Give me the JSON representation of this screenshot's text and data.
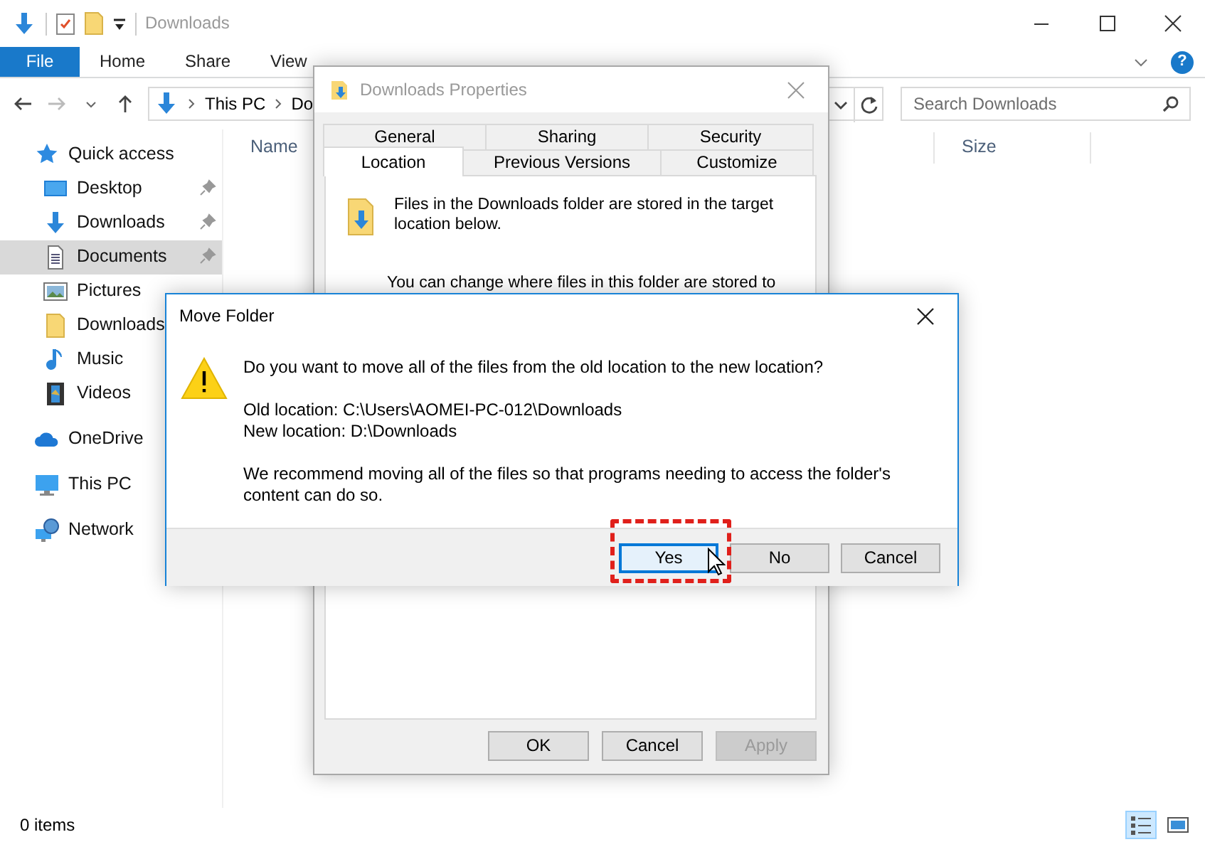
{
  "explorer": {
    "title": "Downloads",
    "ribbon_tabs": [
      {
        "label": "File",
        "kind": "file"
      },
      {
        "label": "Home",
        "kind": "tab"
      },
      {
        "label": "Share",
        "kind": "tab"
      },
      {
        "label": "View",
        "kind": "tab"
      }
    ],
    "help": "?",
    "address": [
      "This PC",
      "Do"
    ],
    "search": {
      "placeholder": "Search Downloads"
    },
    "columns": [
      "Name",
      "Size"
    ],
    "sidebar": [
      {
        "label": "Quick access",
        "kind": "star",
        "selected": false,
        "children": [
          {
            "label": "Desktop",
            "kind": "desktop",
            "pinned": true,
            "selected": false
          },
          {
            "label": "Downloads",
            "kind": "download",
            "pinned": true,
            "selected": false
          },
          {
            "label": "Documents",
            "kind": "document",
            "pinned": true,
            "selected": true
          },
          {
            "label": "Pictures",
            "kind": "picture",
            "pinned": false,
            "selected": false
          },
          {
            "label": "Downloads",
            "kind": "folder",
            "pinned": false,
            "selected": false
          },
          {
            "label": "Music",
            "kind": "music",
            "pinned": false,
            "selected": false
          },
          {
            "label": "Videos",
            "kind": "film",
            "pinned": false,
            "selected": false
          }
        ]
      },
      {
        "label": "OneDrive",
        "kind": "cloud",
        "selected": false
      },
      {
        "label": "This PC",
        "kind": "monitor",
        "selected": false
      },
      {
        "label": "Network",
        "kind": "network",
        "selected": false
      }
    ],
    "status": "0 items",
    "views": [
      {
        "kind": "details",
        "selected": true
      },
      {
        "kind": "tiles",
        "selected": false
      }
    ]
  },
  "properties": {
    "title": "Downloads Properties",
    "tab_rows": [
      [
        {
          "label": "General",
          "selected": false
        },
        {
          "label": "Sharing",
          "selected": false
        },
        {
          "label": "Security",
          "selected": false
        }
      ],
      [
        {
          "label": "Location",
          "selected": true
        },
        {
          "label": "Previous Versions",
          "selected": false
        },
        {
          "label": "Customize",
          "selected": false
        }
      ]
    ],
    "info": "Files in the Downloads folder are stored in the target location below.",
    "note": "You can change where files in this folder are stored to",
    "buttons": [
      {
        "label": "OK",
        "disabled": false
      },
      {
        "label": "Cancel",
        "disabled": false
      },
      {
        "label": "Apply",
        "disabled": true
      }
    ]
  },
  "move_folder": {
    "title": "Move Folder",
    "question": "Do you want to move all of the files from the old location to the new location?",
    "old_location": "Old location: C:\\Users\\AOMEI-PC-012\\Downloads",
    "new_location": "New location: D:\\Downloads",
    "recommendation": "We recommend moving all of the files so that programs needing to access the folder's content can do so.",
    "buttons": [
      {
        "label": "Yes",
        "default": true,
        "highlighted": true
      },
      {
        "label": "No",
        "default": false,
        "highlighted": false
      },
      {
        "label": "Cancel",
        "default": false,
        "highlighted": false
      }
    ]
  }
}
